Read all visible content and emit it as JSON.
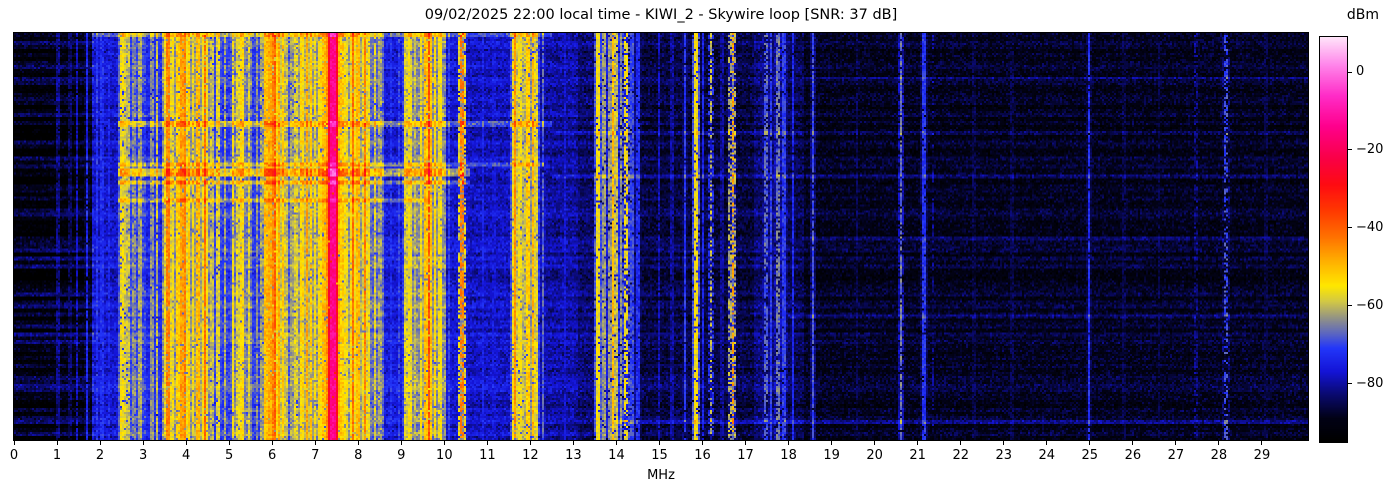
{
  "chart_data": {
    "type": "heatmap",
    "kind": "radio-spectrum-waterfall",
    "title": "09/02/2025 22:00 local time - KIWI_2 - Skywire loop [SNR: 37 dB]",
    "xlabel": "MHz",
    "ylabel": "",
    "x_range_mhz": [
      0,
      30.07
    ],
    "x_ticks": [
      0,
      1,
      2,
      3,
      4,
      5,
      6,
      7,
      8,
      9,
      10,
      11,
      12,
      13,
      14,
      15,
      16,
      17,
      18,
      19,
      20,
      21,
      22,
      23,
      24,
      25,
      26,
      27,
      28,
      29
    ],
    "grid": false,
    "legend": "none",
    "colorbar": {
      "label": "dBm",
      "vmin": -95,
      "vmax": 9,
      "ticks": [
        {
          "v": 0,
          "label": "0"
        },
        {
          "v": -20,
          "label": "−20"
        },
        {
          "v": -40,
          "label": "−40"
        },
        {
          "v": -60,
          "label": "−60"
        },
        {
          "v": -80,
          "label": "−80"
        }
      ]
    },
    "colormap_stops": [
      [
        -95,
        0,
        0,
        0
      ],
      [
        -89,
        2,
        2,
        22
      ],
      [
        -83,
        10,
        10,
        110
      ],
      [
        -77,
        20,
        20,
        215
      ],
      [
        -71,
        35,
        55,
        250
      ],
      [
        -67,
        95,
        105,
        190
      ],
      [
        -63,
        150,
        150,
        130
      ],
      [
        -59,
        210,
        200,
        70
      ],
      [
        -55,
        255,
        232,
        0
      ],
      [
        -49,
        255,
        180,
        0
      ],
      [
        -43,
        255,
        120,
        0
      ],
      [
        -36,
        255,
        60,
        0
      ],
      [
        -29,
        255,
        12,
        18
      ],
      [
        -22,
        250,
        0,
        72
      ],
      [
        -14,
        255,
        0,
        140
      ],
      [
        -6,
        255,
        45,
        200
      ],
      [
        2,
        255,
        135,
        235
      ],
      [
        9,
        255,
        228,
        250
      ]
    ],
    "noise_floor_bands_mhz_dbm": [
      [
        0,
        1.82,
        -90
      ],
      [
        1.82,
        2.42,
        -77
      ],
      [
        2.42,
        3.08,
        -70
      ],
      [
        3.08,
        3.42,
        -74
      ],
      [
        3.42,
        4.55,
        -64
      ],
      [
        4.55,
        5.05,
        -71
      ],
      [
        5.05,
        5.55,
        -65
      ],
      [
        5.55,
        5.82,
        -71
      ],
      [
        5.82,
        6.35,
        -60
      ],
      [
        6.35,
        6.62,
        -68
      ],
      [
        6.62,
        7.32,
        -63
      ],
      [
        7.32,
        7.55,
        -55
      ],
      [
        7.55,
        8.28,
        -63
      ],
      [
        8.28,
        8.6,
        -67
      ],
      [
        8.6,
        9.05,
        -76
      ],
      [
        9.05,
        10.02,
        -64
      ],
      [
        10.02,
        10.55,
        -77
      ],
      [
        10.55,
        11.55,
        -78
      ],
      [
        11.55,
        12.18,
        -67
      ],
      [
        12.18,
        13.1,
        -80
      ],
      [
        13.1,
        14.45,
        -83
      ],
      [
        14.45,
        17.2,
        -86
      ],
      [
        17.2,
        18.0,
        -83
      ],
      [
        18.0,
        18.35,
        -85
      ],
      [
        18.35,
        30.07,
        -88.5
      ]
    ],
    "carriers_f_dbm_halfwidth_flicker": [
      [
        1.02,
        -82,
        0.035,
        0.08
      ],
      [
        1.3,
        -84,
        0.035,
        0.08
      ],
      [
        1.47,
        -79,
        0.035,
        0.08
      ],
      [
        1.7,
        -74,
        0.035,
        0.08
      ],
      [
        1.84,
        -77,
        0.035,
        0.08
      ],
      [
        1.92,
        -72,
        0.035,
        0.08
      ],
      [
        2.05,
        -73,
        0.035,
        0.08
      ],
      [
        2.21,
        -74,
        0.035,
        0.08
      ],
      [
        2.5,
        -56,
        0.035,
        0.08
      ],
      [
        2.57,
        -58,
        0.035,
        0.08
      ],
      [
        2.65,
        -60,
        0.035,
        0.08
      ],
      [
        2.78,
        -64,
        0.035,
        0.08
      ],
      [
        2.92,
        -62,
        0.035,
        0.08
      ],
      [
        3.2,
        -64,
        0.035,
        0.08
      ],
      [
        3.33,
        -60,
        0.035,
        0.08
      ],
      [
        3.58,
        -44,
        0.035,
        0.08
      ],
      [
        3.7,
        -56,
        0.035,
        0.08
      ],
      [
        3.8,
        -52,
        0.035,
        0.08
      ],
      [
        3.9,
        -47,
        0.035,
        0.08
      ],
      [
        3.98,
        -44,
        0.035,
        0.08
      ],
      [
        4.07,
        -52,
        0.035,
        0.08
      ],
      [
        4.17,
        -55,
        0.035,
        0.08
      ],
      [
        4.28,
        -50,
        0.035,
        0.08
      ],
      [
        4.44,
        -42,
        0.035,
        0.08
      ],
      [
        4.6,
        -60,
        0.035,
        0.08
      ],
      [
        4.75,
        -58,
        0.035,
        0.08
      ],
      [
        4.9,
        -62,
        0.035,
        0.08
      ],
      [
        5.1,
        -56,
        0.035,
        0.08
      ],
      [
        5.2,
        -58,
        0.035,
        0.08
      ],
      [
        5.3,
        -54,
        0.035,
        0.08
      ],
      [
        5.45,
        -58,
        0.035,
        0.08
      ],
      [
        5.65,
        -64,
        0.035,
        0.08
      ],
      [
        5.75,
        -62,
        0.035,
        0.08
      ],
      [
        5.85,
        -50,
        0.035,
        0.08
      ],
      [
        5.95,
        -48,
        0.035,
        0.08
      ],
      [
        6.02,
        -44,
        0.035,
        0.08
      ],
      [
        6.07,
        -40,
        0.035,
        0.08
      ],
      [
        6.16,
        -48,
        0.035,
        0.08
      ],
      [
        6.25,
        -52,
        0.035,
        0.08
      ],
      [
        6.45,
        -62,
        0.035,
        0.08
      ],
      [
        6.55,
        -58,
        0.035,
        0.08
      ],
      [
        6.7,
        -54,
        0.035,
        0.08
      ],
      [
        6.8,
        -48,
        0.035,
        0.08
      ],
      [
        6.9,
        -52,
        0.035,
        0.08
      ],
      [
        7.0,
        -56,
        0.035,
        0.08
      ],
      [
        7.1,
        -54,
        0.035,
        0.08
      ],
      [
        7.2,
        -50,
        0.035,
        0.08
      ],
      [
        7.33,
        -32,
        0.02,
        0.05
      ],
      [
        7.42,
        -14,
        0.075,
        0.02
      ],
      [
        7.52,
        -36,
        0.02,
        0.05
      ],
      [
        7.62,
        -52,
        0.035,
        0.08
      ],
      [
        7.72,
        -56,
        0.035,
        0.08
      ],
      [
        7.88,
        -42,
        0.035,
        0.08
      ],
      [
        8.0,
        -50,
        0.035,
        0.08
      ],
      [
        8.16,
        -44,
        0.035,
        0.08
      ],
      [
        8.24,
        -56,
        0.035,
        0.08
      ],
      [
        8.4,
        -58,
        0.035,
        0.08
      ],
      [
        8.5,
        -62,
        0.035,
        0.08
      ],
      [
        8.75,
        -73,
        0.035,
        0.08
      ],
      [
        8.95,
        -71,
        0.035,
        0.08
      ],
      [
        9.1,
        -58,
        0.035,
        0.08
      ],
      [
        9.2,
        -56,
        0.035,
        0.08
      ],
      [
        9.32,
        -60,
        0.035,
        0.08
      ],
      [
        9.45,
        -56,
        0.035,
        0.08
      ],
      [
        9.55,
        -50,
        0.035,
        0.08
      ],
      [
        9.65,
        -38,
        0.035,
        0.08
      ],
      [
        9.78,
        -54,
        0.035,
        0.08
      ],
      [
        9.9,
        -56,
        0.035,
        0.08
      ],
      [
        10.12,
        -71,
        0.035,
        0.08
      ],
      [
        10.42,
        -44,
        0.035,
        0.3
      ],
      [
        10.9,
        -75,
        0.035,
        0.08
      ],
      [
        11.15,
        -77,
        0.035,
        0.08
      ],
      [
        11.6,
        -56,
        0.035,
        0.08
      ],
      [
        11.65,
        -46,
        0.035,
        0.08
      ],
      [
        11.75,
        -56,
        0.035,
        0.08
      ],
      [
        11.86,
        -60,
        0.035,
        0.08
      ],
      [
        11.95,
        -52,
        0.035,
        0.08
      ],
      [
        12.05,
        -50,
        0.035,
        0.08
      ],
      [
        12.12,
        -58,
        0.035,
        0.08
      ],
      [
        12.3,
        -68,
        0.035,
        0.08
      ],
      [
        12.8,
        -77,
        0.035,
        0.08
      ],
      [
        13.56,
        -56,
        0.035,
        0.08
      ],
      [
        13.7,
        -63,
        0.035,
        0.08
      ],
      [
        13.91,
        -50,
        0.035,
        0.08
      ],
      [
        14.0,
        -60,
        0.035,
        0.08
      ],
      [
        14.1,
        -64,
        0.035,
        0.08
      ],
      [
        14.21,
        -56,
        0.035,
        0.35
      ],
      [
        14.35,
        -70,
        0.035,
        0.08
      ],
      [
        14.5,
        -73,
        0.035,
        0.08
      ],
      [
        15.0,
        -79,
        0.035,
        0.08
      ],
      [
        15.3,
        -81,
        0.035,
        0.08
      ],
      [
        15.6,
        -72,
        0.035,
        0.08
      ],
      [
        15.84,
        -56,
        0.035,
        0.08
      ],
      [
        16.0,
        -75,
        0.035,
        0.08
      ],
      [
        16.19,
        -60,
        0.035,
        0.5
      ],
      [
        16.45,
        -81,
        0.035,
        0.08
      ],
      [
        16.7,
        -48,
        0.035,
        0.45
      ],
      [
        17.48,
        -68,
        0.035,
        0.3
      ],
      [
        17.6,
        -71,
        0.035,
        0.08
      ],
      [
        17.75,
        -66,
        0.035,
        0.3
      ],
      [
        17.9,
        -71,
        0.035,
        0.08
      ],
      [
        18.1,
        -74,
        0.035,
        0.08
      ],
      [
        18.56,
        -70,
        0.035,
        0.08
      ],
      [
        19.6,
        -85,
        0.035,
        0.08
      ],
      [
        20.6,
        -66,
        0.015,
        0.2
      ],
      [
        21.14,
        -72,
        0.035,
        0.08
      ],
      [
        21.35,
        -81,
        0.035,
        0.6
      ],
      [
        22.3,
        -86,
        0.035,
        0.08
      ],
      [
        23.2,
        -86,
        0.035,
        0.08
      ],
      [
        24.98,
        -73,
        0.035,
        0.08
      ],
      [
        25.8,
        -86,
        0.035,
        0.08
      ],
      [
        26.6,
        -86,
        0.035,
        0.08
      ],
      [
        27.47,
        -82,
        0.035,
        0.5
      ],
      [
        28.16,
        -70,
        0.035,
        0.5
      ],
      [
        29.1,
        -86,
        0.035,
        0.08
      ]
    ],
    "broadband_row_events_yfrac_h_f0_f1_boostdb": [
      [
        0.0,
        0.008,
        1.82,
        12.5,
        8
      ],
      [
        0.215,
        0.013,
        2.4,
        12.5,
        9
      ],
      [
        0.318,
        0.01,
        2.4,
        12.3,
        8
      ],
      [
        0.332,
        0.02,
        2.4,
        10.6,
        13
      ],
      [
        0.358,
        0.012,
        2.4,
        10.6,
        11
      ],
      [
        0.402,
        0.01,
        2.4,
        9.6,
        8
      ],
      [
        0.24,
        0.008,
        12.5,
        30.07,
        5
      ],
      [
        0.345,
        0.008,
        12.5,
        30.07,
        6
      ],
      [
        0.69,
        0.008,
        18.0,
        30.07,
        5
      ],
      [
        0.95,
        0.007,
        14.0,
        30.07,
        5
      ],
      [
        0.5,
        0.006,
        18.3,
        30.07,
        4
      ],
      [
        0.105,
        0.006,
        18.3,
        30.07,
        4
      ]
    ]
  }
}
